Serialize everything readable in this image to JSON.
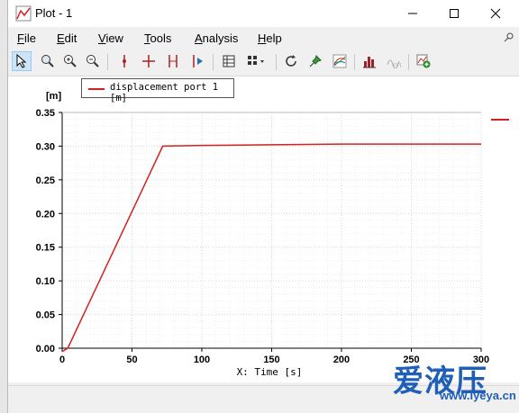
{
  "window": {
    "title": "Plot - 1"
  },
  "menu": [
    {
      "label": "File",
      "u": "F",
      "rest": "ile"
    },
    {
      "label": "Edit",
      "u": "E",
      "rest": "dit"
    },
    {
      "label": "View",
      "u": "V",
      "rest": "iew"
    },
    {
      "label": "Tools",
      "u": "T",
      "rest": "ools"
    },
    {
      "label": "Analysis",
      "u": "A",
      "rest": "nalysis"
    },
    {
      "label": "Help",
      "u": "H",
      "rest": "elp"
    }
  ],
  "toolbar": {
    "tools": [
      "select-arrow-icon",
      "zoom-region-icon",
      "zoom-in-icon",
      "zoom-out-icon",
      "vertical-cursor-icon",
      "crosshair-cursor-icon",
      "double-cursor-icon",
      "play-cursor-icon",
      "data-table-icon",
      "grid-layout-icon",
      "refresh-icon",
      "pin-marker-icon",
      "curves-icon",
      "histogram-icon",
      "fft-icon",
      "add-plot-icon"
    ]
  },
  "chart_data": {
    "type": "line",
    "ylabel": "[m]",
    "xlabel": "X: Time [s]",
    "xlim": [
      0,
      300
    ],
    "ylim": [
      0,
      0.35
    ],
    "xticks": [
      "0",
      "50",
      "100",
      "150",
      "200",
      "250",
      "300"
    ],
    "yticks": [
      "0.00",
      "0.05",
      "0.10",
      "0.15",
      "0.20",
      "0.25",
      "0.30",
      "0.35"
    ],
    "grid": true,
    "legend_position": "top-left",
    "series": [
      {
        "name": "displacement port 1 [m]",
        "color": "#d42020",
        "x": [
          0,
          4,
          72,
          100,
          150,
          200,
          250,
          300
        ],
        "y": [
          -0.005,
          0.0,
          0.3,
          0.301,
          0.302,
          0.303,
          0.303,
          0.303
        ]
      }
    ]
  },
  "watermark": {
    "cn": "爱液压",
    "url": "www.iyeya.cn"
  }
}
